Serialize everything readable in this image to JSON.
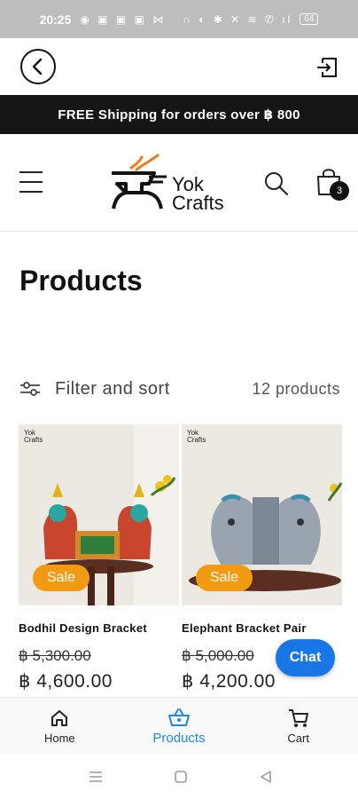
{
  "status_bar": {
    "time": "20:25",
    "battery": "64"
  },
  "announcement": "FREE Shipping for orders over ฿ 800",
  "header": {
    "logo_line1": "Yok",
    "logo_line2": "Crafts",
    "cart_count": "3"
  },
  "page": {
    "title": "Products"
  },
  "filter": {
    "label": "Filter and sort",
    "count": "12 products"
  },
  "products": [
    {
      "title": "Bodhil Design Bracket",
      "old_price": "฿ 5,300.00",
      "new_price": "฿ 4,600.00",
      "badge": "Sale"
    },
    {
      "title": "Elephant Bracket Pair",
      "old_price": "฿ 5,000.00",
      "new_price": "฿ 4,200.00",
      "badge": "Sale"
    }
  ],
  "chat": {
    "label": "Chat"
  },
  "bottom_nav": [
    {
      "label": "Home"
    },
    {
      "label": "Products"
    },
    {
      "label": "Cart"
    }
  ],
  "colors": {
    "accent": "#1e88e5",
    "sale": "#f29a12",
    "chat": "#1976e6",
    "announcement_bg": "#151515",
    "logo_orange": "#f07b1a"
  }
}
